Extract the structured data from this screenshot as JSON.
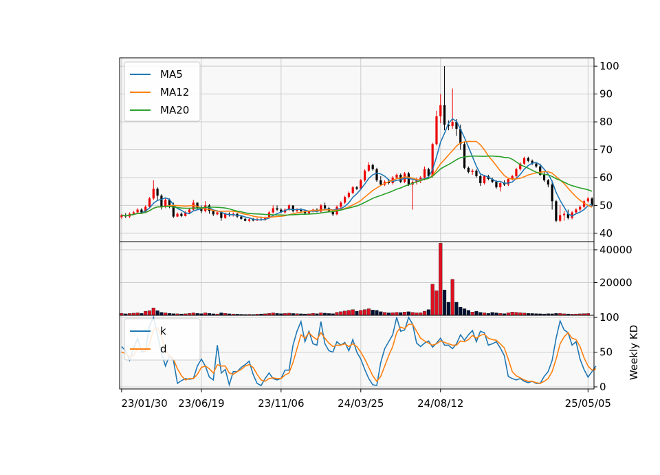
{
  "colors": {
    "plot_background": "#f8f8f8",
    "grid": "#cccccc",
    "up_candle": "#ee0000",
    "down_candle": "#000000",
    "up_volume": "#dd1122",
    "down_volume": "#001133",
    "ma5": "#1f77b4",
    "ma12": "#ff7f0e",
    "ma20": "#2ca02c",
    "k": "#1f77b4",
    "d": "#ff7f0e"
  },
  "chart_data": [
    {
      "type": "candlestick",
      "panel": "price",
      "frequency": "weekly",
      "x_tick_labels": [
        "23/01/30",
        "23/06/19",
        "23/11/06",
        "24/03/25",
        "24/08/12",
        "25/05/05"
      ],
      "x_tick_index": [
        0,
        20,
        40,
        60,
        80,
        117
      ],
      "ylim": [
        37,
        103
      ],
      "yticks": [
        40,
        50,
        60,
        70,
        80,
        90,
        100
      ],
      "grid": true,
      "legend_position": "top-left",
      "legend": [
        "MA5",
        "MA12",
        "MA20"
      ],
      "ohlc": [
        [
          45.8,
          47,
          45.2,
          46.5
        ],
        [
          46.5,
          47.2,
          45.5,
          46
        ],
        [
          46,
          47.5,
          45.5,
          47
        ],
        [
          47,
          48,
          46.5,
          47.5
        ],
        [
          47.5,
          49,
          47,
          48.5
        ],
        [
          48.5,
          49,
          47,
          47.5
        ],
        [
          47.5,
          50,
          47.2,
          49.5
        ],
        [
          49.5,
          53,
          49,
          52.5
        ],
        [
          52.5,
          59,
          52,
          56
        ],
        [
          56,
          56.5,
          52,
          53.5
        ],
        [
          53.5,
          54,
          48.5,
          49.5
        ],
        [
          49.5,
          52.5,
          49,
          52
        ],
        [
          52,
          52.5,
          49,
          50
        ],
        [
          50,
          51,
          45.5,
          46
        ],
        [
          46,
          47.5,
          45.8,
          47
        ],
        [
          47,
          47.5,
          45.8,
          46.2
        ],
        [
          46.2,
          48,
          46,
          47.5
        ],
        [
          47.5,
          49,
          47,
          48.5
        ],
        [
          48.5,
          52,
          48,
          51
        ],
        [
          51,
          51,
          48.5,
          49
        ],
        [
          49,
          50,
          47.2,
          48
        ],
        [
          48,
          51.5,
          47.5,
          50
        ],
        [
          50,
          50.5,
          47,
          48
        ],
        [
          48,
          48.5,
          46.2,
          46.8
        ],
        [
          46.8,
          48,
          46.5,
          47.5
        ],
        [
          47.5,
          48,
          44.5,
          45.5
        ],
        [
          45.5,
          47.5,
          45.2,
          47
        ],
        [
          47,
          47.5,
          46,
          46.5
        ],
        [
          46.5,
          47.5,
          46,
          47
        ],
        [
          47,
          47.2,
          45.5,
          46
        ],
        [
          46,
          46.5,
          44.8,
          45.2
        ],
        [
          45.2,
          45.5,
          44.3,
          44.5
        ],
        [
          44.5,
          45.5,
          44,
          45
        ],
        [
          45,
          45.5,
          44.3,
          44.6
        ],
        [
          44.6,
          45.5,
          44.4,
          45
        ],
        [
          45,
          46,
          44.5,
          44.8
        ],
        [
          44.8,
          46,
          44.5,
          45.5
        ],
        [
          45.5,
          48,
          45.2,
          47.5
        ],
        [
          47.5,
          50,
          47,
          49
        ],
        [
          49,
          50,
          48,
          48.5
        ],
        [
          48.5,
          49,
          47.2,
          47.5
        ],
        [
          47.5,
          49,
          47,
          48.5
        ],
        [
          48.5,
          50.5,
          48,
          50
        ],
        [
          50,
          50,
          47.5,
          48
        ],
        [
          48,
          49,
          47.5,
          48.5
        ],
        [
          48.5,
          49,
          47.5,
          48
        ],
        [
          48,
          48.5,
          47,
          47.2
        ],
        [
          47.2,
          48,
          47,
          47.8
        ],
        [
          47.8,
          48.8,
          47.5,
          48.5
        ],
        [
          48.5,
          49,
          47.5,
          47.8
        ],
        [
          47.8,
          50.5,
          47.5,
          50
        ],
        [
          50,
          51,
          48.5,
          49
        ],
        [
          49,
          49.5,
          47.5,
          48
        ],
        [
          48,
          48.5,
          46.2,
          46.8
        ],
        [
          46.8,
          50,
          46.5,
          49.5
        ],
        [
          49.5,
          51.5,
          49,
          51
        ],
        [
          51,
          53.5,
          50.5,
          53
        ],
        [
          53,
          55,
          52.5,
          54.5
        ],
        [
          54.5,
          57,
          54,
          56.5
        ],
        [
          56.5,
          57,
          55.5,
          56
        ],
        [
          56,
          59.5,
          55.5,
          59
        ],
        [
          59,
          63,
          58.5,
          62.5
        ],
        [
          62.5,
          65.5,
          62,
          64.5
        ],
        [
          64.5,
          65,
          62.5,
          63
        ],
        [
          63,
          63.5,
          58.5,
          59
        ],
        [
          59,
          60.5,
          57,
          57.5
        ],
        [
          57.5,
          59,
          57,
          58.5
        ],
        [
          58.5,
          59.5,
          57.5,
          58
        ],
        [
          58,
          60.5,
          57.5,
          60
        ],
        [
          60,
          61.5,
          59.5,
          61
        ],
        [
          61,
          61.5,
          58,
          58.5
        ],
        [
          58.5,
          62,
          58,
          61.5
        ],
        [
          61.5,
          62,
          57,
          57.5
        ],
        [
          57.5,
          59,
          48.5,
          58.5
        ],
        [
          58.5,
          60,
          57.5,
          59
        ],
        [
          59,
          60.5,
          58,
          60
        ],
        [
          60,
          64,
          59,
          63
        ],
        [
          63,
          63.5,
          60,
          60.5
        ],
        [
          60.5,
          72.5,
          60,
          72
        ],
        [
          72,
          84,
          71.5,
          82
        ],
        [
          82,
          90,
          79.5,
          86
        ],
        [
          86,
          100,
          77,
          79
        ],
        [
          79,
          80.5,
          77,
          78.5
        ],
        [
          78.5,
          92,
          77.5,
          80
        ],
        [
          80,
          81,
          75,
          77.5
        ],
        [
          77.5,
          79,
          70,
          72
        ],
        [
          72,
          73,
          63,
          63.5
        ],
        [
          63.5,
          64,
          61.5,
          62
        ],
        [
          62,
          63,
          61,
          62.5
        ],
        [
          62.5,
          63,
          60,
          60.5
        ],
        [
          60.5,
          61,
          57,
          58
        ],
        [
          58,
          61,
          57.5,
          60.5
        ],
        [
          60.5,
          61,
          59,
          59.5
        ],
        [
          59.5,
          60,
          58,
          58.5
        ],
        [
          58.5,
          59,
          56,
          56.5
        ],
        [
          56.5,
          58.5,
          55,
          58
        ],
        [
          58,
          59,
          57,
          57.5
        ],
        [
          57.5,
          60,
          57,
          59.5
        ],
        [
          59.5,
          61,
          59,
          60.5
        ],
        [
          60.5,
          63.5,
          60,
          63
        ],
        [
          63,
          65.5,
          62.5,
          65
        ],
        [
          65,
          67.5,
          64.5,
          67
        ],
        [
          67,
          67.5,
          65.5,
          66
        ],
        [
          66,
          66.5,
          64.5,
          65
        ],
        [
          65,
          65.5,
          63.5,
          64
        ],
        [
          64,
          65,
          60.5,
          61
        ],
        [
          61,
          62,
          58.5,
          59
        ],
        [
          59,
          59.5,
          56.5,
          57.5
        ],
        [
          57.5,
          59,
          48.5,
          51.5
        ],
        [
          51.5,
          52,
          44,
          44.5
        ],
        [
          44.5,
          50,
          44,
          46.5
        ],
        [
          46.5,
          48,
          44.5,
          47
        ],
        [
          47,
          48.5,
          45,
          45.5
        ],
        [
          45.5,
          48,
          45,
          47.5
        ],
        [
          47.5,
          49,
          47,
          48.5
        ],
        [
          48.5,
          50,
          48,
          49.5
        ],
        [
          49.5,
          52,
          49,
          51.5
        ],
        [
          51.5,
          53,
          51,
          52.5
        ],
        [
          52.5,
          53,
          49.5,
          50
        ]
      ],
      "series": [
        {
          "name": "MA5",
          "window": 5
        },
        {
          "name": "MA12",
          "window": 12
        },
        {
          "name": "MA20",
          "window": 20
        }
      ]
    },
    {
      "type": "bar",
      "panel": "volume",
      "ylim": [
        0,
        45000
      ],
      "yticks": [
        20000,
        40000
      ],
      "grid": true,
      "values": [
        1200,
        900,
        1100,
        1300,
        1500,
        1200,
        2500,
        2800,
        4500,
        2800,
        1800,
        1500,
        1200,
        1000,
        900,
        800,
        900,
        1200,
        1500,
        1200,
        1000,
        1500,
        1200,
        900,
        800,
        1500,
        1200,
        900,
        800,
        700,
        600,
        500,
        600,
        500,
        700,
        800,
        900,
        1200,
        1500,
        1200,
        1000,
        1100,
        1300,
        1100,
        1000,
        900,
        800,
        900,
        1200,
        1000,
        1500,
        1300,
        1100,
        1000,
        1800,
        2200,
        2600,
        3000,
        3500,
        2500,
        3000,
        3500,
        4000,
        3200,
        3000,
        2200,
        1800,
        1500,
        1600,
        1800,
        1700,
        2000,
        2200,
        1800,
        1500,
        1600,
        2500,
        3500,
        19000,
        15000,
        44000,
        15500,
        8000,
        22000,
        8000,
        5000,
        4000,
        3000,
        2000,
        2500,
        1800,
        1500,
        1200,
        1800,
        1500,
        1200,
        1000,
        1500,
        2000,
        1800,
        1600,
        1400,
        1200,
        1100,
        1000,
        900,
        800,
        1000,
        900,
        1200,
        1100,
        900,
        800,
        700,
        800,
        900,
        1000,
        1100
      ]
    },
    {
      "type": "line",
      "panel": "weekly-kd",
      "ylabel": "Weekly KD",
      "ylim": [
        -3,
        103
      ],
      "yticks": [
        0,
        50,
        100
      ],
      "grid": true,
      "legend_position": "top-left",
      "legend": [
        "k",
        "d"
      ],
      "series": [
        {
          "name": "k",
          "values": [
            58,
            52,
            38,
            55,
            70,
            50,
            52,
            88,
            100,
            75,
            48,
            30,
            45,
            38,
            5,
            9,
            12,
            11,
            12,
            30,
            40,
            30,
            14,
            10,
            60,
            20,
            25,
            3,
            22,
            22,
            28,
            32,
            37,
            18,
            5,
            2,
            12,
            20,
            12,
            10,
            12,
            24,
            24,
            60,
            80,
            94,
            65,
            80,
            62,
            60,
            94,
            62,
            52,
            50,
            65,
            60,
            64,
            52,
            68,
            50,
            40,
            25,
            12,
            3,
            2,
            35,
            55,
            65,
            75,
            100,
            80,
            82,
            100,
            90,
            63,
            58,
            63,
            66,
            57,
            63,
            70,
            60,
            60,
            55,
            62,
            75,
            67,
            75,
            81,
            65,
            80,
            78,
            60,
            62,
            65,
            56,
            45,
            15,
            12,
            10,
            12,
            8,
            6,
            8,
            5,
            5,
            15,
            22,
            38,
            70,
            95,
            82,
            78,
            60,
            65,
            40,
            25,
            14,
            22,
            30
          ]
        },
        {
          "name": "d",
          "values": [
            50,
            48,
            44,
            45,
            55,
            54,
            51,
            62,
            82,
            85,
            72,
            52,
            45,
            40,
            26,
            16,
            10,
            12,
            12,
            18,
            28,
            30,
            26,
            20,
            32,
            30,
            30,
            20,
            18,
            22,
            25,
            30,
            32,
            28,
            18,
            10,
            8,
            12,
            13,
            12,
            12,
            17,
            20,
            35,
            55,
            75,
            70,
            78,
            72,
            68,
            78,
            70,
            63,
            58,
            60,
            60,
            62,
            58,
            62,
            58,
            50,
            40,
            28,
            16,
            8,
            15,
            30,
            45,
            58,
            78,
            86,
            84,
            90,
            90,
            80,
            70,
            66,
            63,
            60,
            62,
            66,
            64,
            62,
            60,
            60,
            66,
            65,
            68,
            74,
            70,
            74,
            76,
            70,
            68,
            67,
            62,
            56,
            40,
            22,
            16,
            13,
            10,
            8,
            8,
            6,
            5,
            8,
            12,
            22,
            40,
            62,
            72,
            78,
            70,
            68,
            58,
            42,
            30,
            24,
            26
          ]
        }
      ]
    }
  ]
}
